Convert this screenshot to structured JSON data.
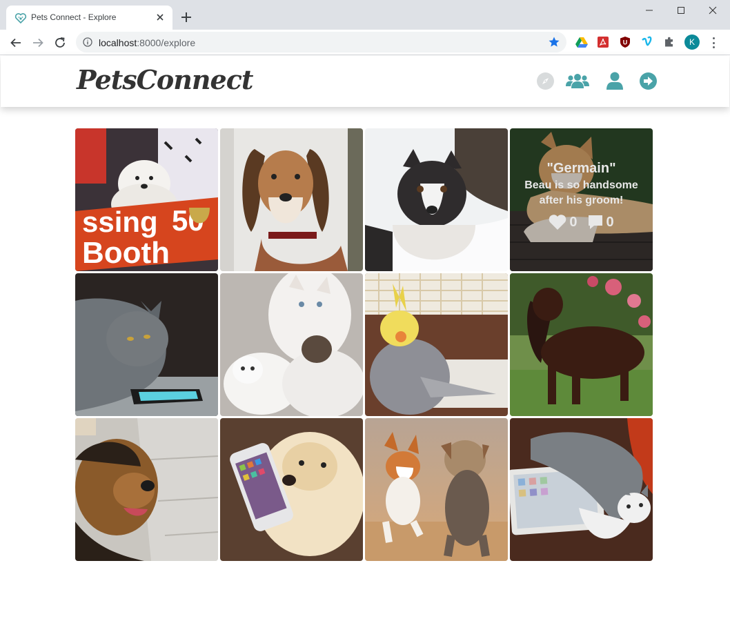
{
  "browser": {
    "tab_title": "Pets Connect - Explore",
    "url_host": "localhost",
    "url_path": ":8000/explore",
    "profile_initial": "K"
  },
  "header": {
    "logo": "PetsConnect",
    "nav_icons": [
      "compass-icon",
      "users-icon",
      "user-icon",
      "sign-out-icon"
    ],
    "accent_color": "#4aa3a8"
  },
  "posts": [
    {
      "subject": "samoyed with sign"
    },
    {
      "subject": "saluki dog"
    },
    {
      "subject": "husky in snow"
    },
    {
      "subject": "akita on deck",
      "hovered": true,
      "name": "\"Germain\"",
      "caption": "Beau is so handsome after his groom!",
      "likes": "0",
      "comments": "0"
    },
    {
      "subject": "grey cat with phone"
    },
    {
      "subject": "white cat with kittens"
    },
    {
      "subject": "cockatiel"
    },
    {
      "subject": "spaniel in garden"
    },
    {
      "subject": "airedale terrier"
    },
    {
      "subject": "golden retriever with phone"
    },
    {
      "subject": "corgi and yorkie running"
    },
    {
      "subject": "cat on tablet"
    }
  ]
}
